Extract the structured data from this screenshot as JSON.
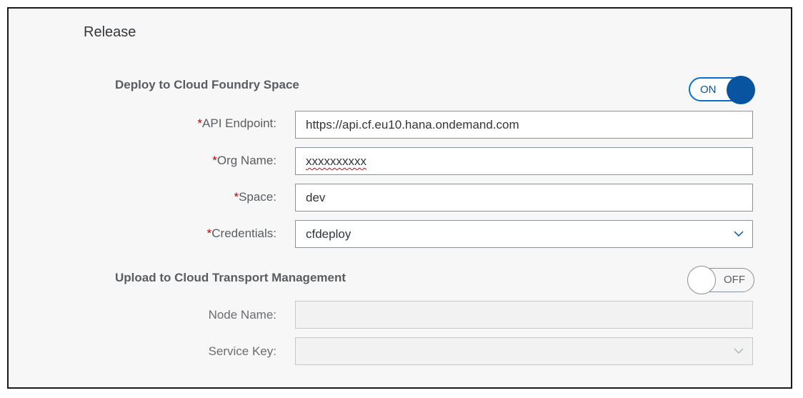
{
  "panel": {
    "title": "Release"
  },
  "deploy": {
    "section_title": "Deploy to Cloud Foundry Space",
    "toggle_label": "ON",
    "fields": {
      "api_endpoint": {
        "label": "API Endpoint:",
        "value": "https://api.cf.eu10.hana.ondemand.com"
      },
      "org_name": {
        "label": "Org Name:",
        "value": "xxxxxxxxxx"
      },
      "space": {
        "label": "Space:",
        "value": "dev"
      },
      "credentials": {
        "label": "Credentials:",
        "value": "cfdeploy"
      }
    },
    "required_marker": "*"
  },
  "upload": {
    "section_title": "Upload to Cloud Transport Management",
    "toggle_label": "OFF",
    "fields": {
      "node_name": {
        "label": "Node Name:",
        "value": ""
      },
      "service_key": {
        "label": "Service Key:",
        "value": ""
      }
    }
  },
  "colors": {
    "accent": "#0854a0",
    "required": "#bb0000",
    "panel_bg": "#f7f7f7"
  },
  "icons": {
    "dropdown": "chevron-down-icon"
  }
}
